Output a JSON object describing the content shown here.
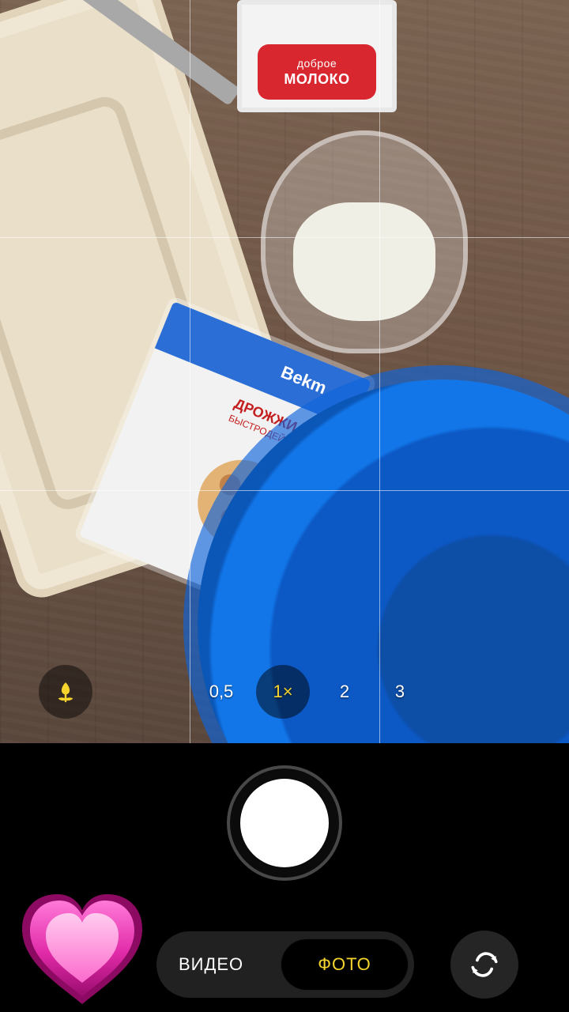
{
  "camera": {
    "zoom": {
      "options": [
        "0,5",
        "1×",
        "2",
        "3"
      ],
      "selected_index": 1
    },
    "modes": {
      "video_label": "ВИДЕО",
      "photo_label": "ФОТО",
      "selected": "ФОТО"
    },
    "icons": {
      "macro": "macro-tulip-icon",
      "flip_camera": "flip-camera-icon",
      "gallery": "heart-emoji-icon"
    },
    "colors": {
      "accent_yellow": "#f5d52d",
      "background": "#000000"
    }
  },
  "scene_text": {
    "milk_small": "доброе",
    "milk_big": "МОЛОКО",
    "yeast_brand": "Bekm",
    "yeast_title": "ДРОЖЖИ",
    "yeast_subtitle": "БЫСТРОДЕЙСТВУЮЩ"
  }
}
